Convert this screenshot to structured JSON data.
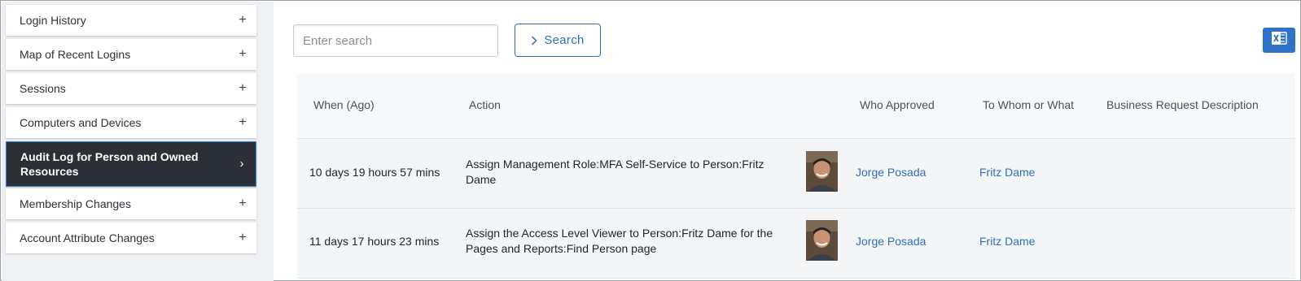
{
  "sidebar": {
    "items": [
      {
        "label": "Login History",
        "icon": "plus"
      },
      {
        "label": "Map of Recent Logins",
        "icon": "plus"
      },
      {
        "label": "Sessions",
        "icon": "plus"
      },
      {
        "label": "Computers and Devices",
        "icon": "plus"
      },
      {
        "label": "Audit Log for Person and Owned Resources",
        "icon": "chevron-right",
        "active": true
      },
      {
        "label": "Membership Changes",
        "icon": "plus"
      },
      {
        "label": "Account Attribute Changes",
        "icon": "plus"
      }
    ],
    "plus_glyph": "+",
    "chevron_glyph": "›"
  },
  "search": {
    "placeholder": "Enter search",
    "value": "",
    "button_label": "Search"
  },
  "excel_button": {
    "icon": "excel-icon",
    "letter": "X",
    "color": "#2f73c8"
  },
  "table": {
    "headers": [
      "When (Ago)",
      "Action",
      "Who Approved",
      "To Whom or What",
      "Business Request Description"
    ],
    "rows": [
      {
        "when": "10 days 19 hours 57 mins",
        "action": "Assign Management Role:MFA Self-Service to Person:Fritz Dame",
        "who_approved": "Jorge Posada",
        "to_whom": "Fritz Dame",
        "description": ""
      },
      {
        "when": "11 days 17 hours 23 mins",
        "action": "Assign the Access Level Viewer to Person:Fritz Dame for the Pages and Reports:Find Person page",
        "who_approved": "Jorge Posada",
        "to_whom": "Fritz Dame",
        "description": ""
      }
    ]
  },
  "colors": {
    "accent": "#2f6fb3",
    "link": "#2f6fc0",
    "active_bg": "#2a2f38"
  }
}
